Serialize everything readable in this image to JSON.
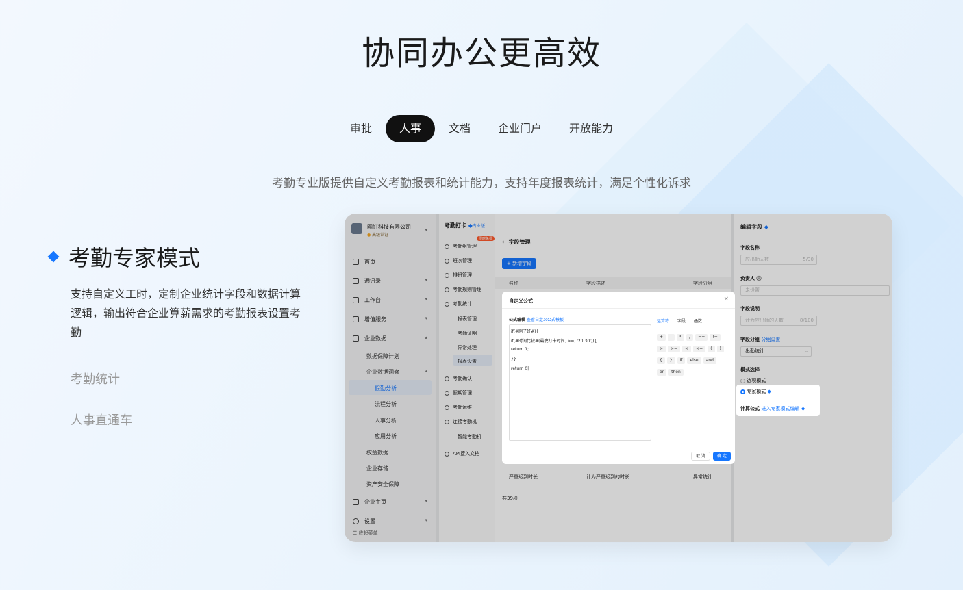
{
  "hero": {
    "title": "协同办公更高效",
    "subtitle": "考勤专业版提供自定义考勤报表和统计能力，支持年度报表统计，满足个性化诉求"
  },
  "tabs": [
    {
      "label": "审批",
      "active": false
    },
    {
      "label": "人事",
      "active": true
    },
    {
      "label": "文档",
      "active": false
    },
    {
      "label": "企业门户",
      "active": false
    },
    {
      "label": "开放能力",
      "active": false
    }
  ],
  "feature": {
    "title": "考勤专家模式",
    "desc": "支持自定义工时，定制企业统计字段和数据计算逻辑，输出符合企业算薪需求的考勤报表设置考勤",
    "others": [
      "考勤统计",
      "人事直通车"
    ]
  },
  "app": {
    "company": "网钉科技有限公司",
    "cert": "高级认证",
    "sidebar": [
      "首页",
      "通讯录",
      "工作台",
      "增值服务",
      "企业数据"
    ],
    "sidebar_sub": [
      "数据保障计划",
      "企业数据洞察"
    ],
    "sidebar_sub2": [
      "假勤分析",
      "流程分析",
      "人事分析",
      "应用分析"
    ],
    "sidebar_more": [
      "权益数据",
      "企业存储",
      "资产安全保障"
    ],
    "sidebar_bottom": [
      "企业主页",
      "设置"
    ],
    "collapse": "收起菜单",
    "module_title": "考勤打卡",
    "module_badge": "专业版",
    "mid_menu": [
      "考勤组管理",
      "班次管理",
      "排班管理",
      "考勤规则管理",
      "考勤统计"
    ],
    "mid_new": "限时免费",
    "mid_sub": [
      "报表管理",
      "考勤证明",
      "异常处理",
      "报表设置"
    ],
    "mid_more": [
      "考勤确认",
      "假期管理",
      "考勤运维",
      "连接考勤机"
    ],
    "mid_sub3": "智能考勤机",
    "mid_api": "API接入文档",
    "page_title": "字段管理",
    "add_btn": "+ 新增字段",
    "table_cols": [
      "名称",
      "字段描述",
      "字段分组"
    ],
    "table_row": [
      "严重迟到时长",
      "计为严重迟到的时长",
      "异常统计"
    ],
    "total": "共39项",
    "modal": {
      "title": "自定义公式",
      "editor_label": "公式编辑",
      "doc_link": "查看自定义公式模板",
      "code": [
        "if(#刚了班#){",
        "if(#时间比较#(最晚打卡时间, >=, '20:30')){",
        "return 1;",
        "}}",
        "return 0|"
      ],
      "tabs": [
        "运算符",
        "字段",
        "函数"
      ],
      "ops1": [
        "+",
        "-",
        "*",
        "/",
        "==",
        "!="
      ],
      "ops2": [
        ">",
        ">=",
        "<",
        "<=",
        "(",
        ")"
      ],
      "ops3": [
        "{",
        "}",
        "if",
        "else",
        "and"
      ],
      "ops4": [
        "or",
        "then"
      ],
      "cancel": "取 消",
      "ok": "确 定"
    },
    "right": {
      "title": "编辑字段",
      "name_label": "字段名称",
      "name_val": "应出勤天数",
      "name_count": "5/30",
      "owner_label": "负责人",
      "owner_val": "未设置",
      "desc_label": "字段说明",
      "desc_val": "计为应出勤的天数",
      "desc_count": "8/100",
      "group_label": "字段分组",
      "group_link": "分组设置",
      "group_val": "出勤统计",
      "mode_label": "模式选择",
      "mode_opt1": "选项模式",
      "mode_opt2": "专家模式",
      "formula_label": "计算公式",
      "formula_link": "进入专家模式编辑"
    }
  }
}
